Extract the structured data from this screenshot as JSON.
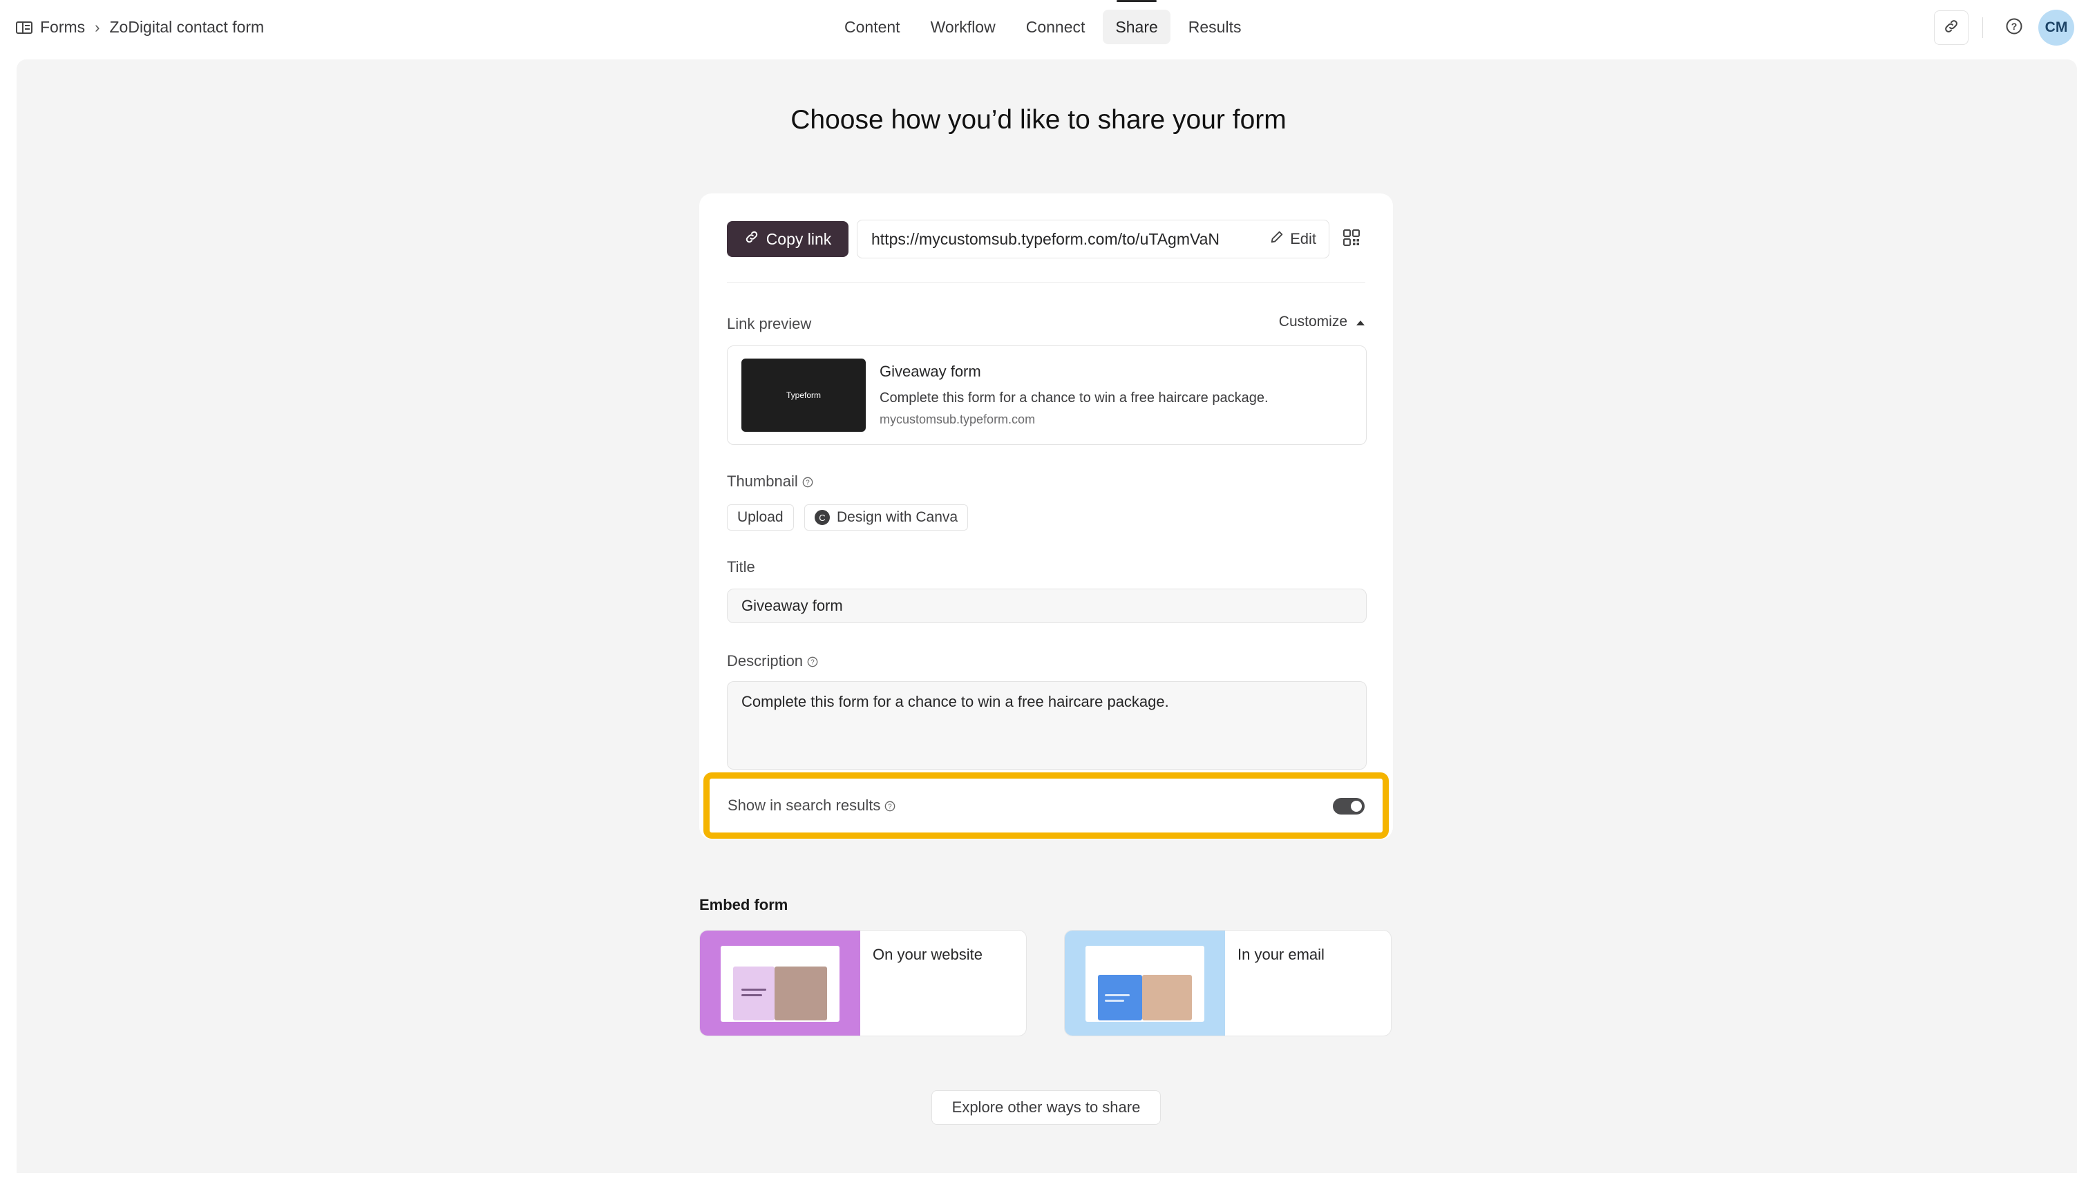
{
  "breadcrumb": {
    "root": "Forms",
    "current": "ZoDigital contact form"
  },
  "tabs": [
    "Content",
    "Workflow",
    "Connect",
    "Share",
    "Results"
  ],
  "active_tab": "Share",
  "user": {
    "initials": "CM"
  },
  "page": {
    "title": "Choose how you’d like to share your form"
  },
  "share": {
    "copy_link_label": "Copy link",
    "url": "https://mycustomsub.typeform.com/to/uTAgmVaN",
    "edit_label": "Edit"
  },
  "link_preview": {
    "label": "Link preview",
    "customize_label": "Customize",
    "thumb_text": "Typeform",
    "title": "Giveaway form",
    "description": "Complete this form for a chance to win a free haircare package.",
    "domain": "mycustomsub.typeform.com"
  },
  "thumbnail": {
    "label": "Thumbnail",
    "upload_label": "Upload",
    "canva_label": "Design with Canva",
    "canva_icon_letter": "C"
  },
  "title_field": {
    "label": "Title",
    "value": "Giveaway form"
  },
  "description_field": {
    "label": "Description",
    "value": "Complete this form for a chance to win a free haircare package."
  },
  "search_results": {
    "label": "Show in search results",
    "enabled": true
  },
  "embed": {
    "title": "Embed form",
    "options": [
      {
        "label": "On your website",
        "bg_color": "#c97fe0"
      },
      {
        "label": "In your email",
        "bg_color": "#b5daf7"
      }
    ]
  },
  "explore_label": "Explore other ways to share",
  "colors": {
    "highlight": "#f5b400",
    "copy_button": "#3d2e3a",
    "canvas": "#f4f4f4"
  }
}
